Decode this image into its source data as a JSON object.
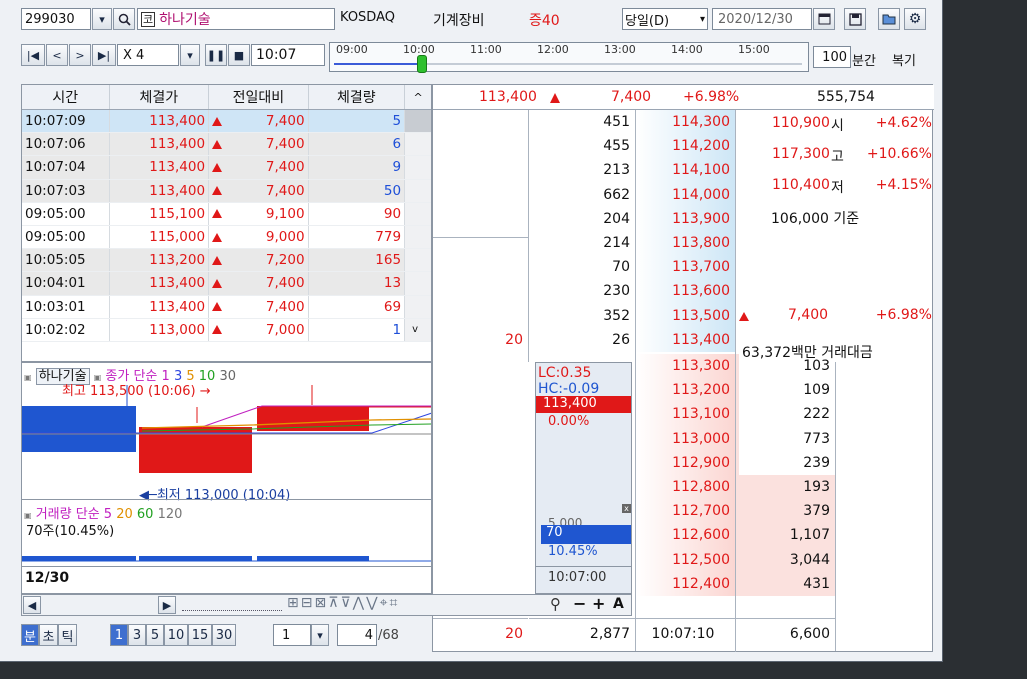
{
  "toolbar": {
    "code": "299030",
    "market_badge": "코",
    "stock_name": "하나기술",
    "exchange": "KOSDAQ",
    "sector": "기계장비",
    "margin": "증40",
    "period_select": "당일(D)",
    "date": "2020/12/30"
  },
  "toolbar2": {
    "speed": "X 4",
    "time": "10:07",
    "timeline_ticks": [
      "09:00",
      "10:00",
      "11:00",
      "12:00",
      "13:00",
      "14:00",
      "15:00"
    ],
    "interval_value": "100",
    "interval_unit": "분간",
    "restore": "복기"
  },
  "ticks": {
    "headers": [
      "시간",
      "체결가",
      "전일대비",
      "체결량"
    ],
    "rows": [
      {
        "time": "10:07:09",
        "price": "113,400",
        "change": "7,400",
        "vol": "5",
        "vol_color": "blue",
        "style": "sel"
      },
      {
        "time": "10:07:06",
        "price": "113,400",
        "change": "7,400",
        "vol": "6",
        "vol_color": "blue",
        "style": "alt"
      },
      {
        "time": "10:07:04",
        "price": "113,400",
        "change": "7,400",
        "vol": "9",
        "vol_color": "blue",
        "style": "alt"
      },
      {
        "time": "10:07:03",
        "price": "113,400",
        "change": "7,400",
        "vol": "50",
        "vol_color": "blue",
        "style": "alt"
      },
      {
        "time": "09:05:00",
        "price": "115,100",
        "change": "9,100",
        "vol": "90",
        "vol_color": "red",
        "style": ""
      },
      {
        "time": "09:05:00",
        "price": "115,000",
        "change": "9,000",
        "vol": "779",
        "vol_color": "red",
        "style": ""
      },
      {
        "time": "10:05:05",
        "price": "113,200",
        "change": "7,200",
        "vol": "165",
        "vol_color": "red",
        "style": "alt"
      },
      {
        "time": "10:04:01",
        "price": "113,400",
        "change": "7,400",
        "vol": "13",
        "vol_color": "red",
        "style": "alt"
      },
      {
        "time": "10:03:01",
        "price": "113,400",
        "change": "7,400",
        "vol": "69",
        "vol_color": "red",
        "style": ""
      },
      {
        "time": "10:02:02",
        "price": "113,000",
        "change": "7,000",
        "vol": "1",
        "vol_color": "blue",
        "style": ""
      }
    ]
  },
  "quote": {
    "price": "113,400",
    "change": "7,400",
    "pct": "+6.98%",
    "volume": "555,754"
  },
  "asks": [
    {
      "qty": "451",
      "price": "114,300"
    },
    {
      "qty": "455",
      "price": "114,200"
    },
    {
      "qty": "213",
      "price": "114,100"
    },
    {
      "qty": "662",
      "price": "114,000"
    },
    {
      "qty": "204",
      "price": "113,900"
    },
    {
      "qty": "214",
      "price": "113,800"
    },
    {
      "qty": "70",
      "price": "113,700"
    },
    {
      "qty": "230",
      "price": "113,600"
    },
    {
      "qty": "352",
      "price": "113,500"
    },
    {
      "qty": "26",
      "price": "113,400"
    }
  ],
  "ask_extra": "20",
  "bids": [
    {
      "price": "113,300",
      "qty": "103"
    },
    {
      "price": "113,200",
      "qty": "109"
    },
    {
      "price": "113,100",
      "qty": "222"
    },
    {
      "price": "113,000",
      "qty": "773"
    },
    {
      "price": "112,900",
      "qty": "239"
    },
    {
      "price": "112,800",
      "qty": "193"
    },
    {
      "price": "112,700",
      "qty": "379"
    },
    {
      "price": "112,600",
      "qty": "1,107"
    },
    {
      "price": "112,500",
      "qty": "3,044"
    },
    {
      "price": "112,400",
      "qty": "431"
    }
  ],
  "info": {
    "open": "110,900",
    "open_label": "시",
    "open_pct": "+4.62%",
    "high": "117,300",
    "high_label": "고",
    "high_pct": "+10.66%",
    "low": "110,400",
    "low_label": "저",
    "low_pct": "+4.15%",
    "base": "106,000",
    "base_label": "기준",
    "change": "7,400",
    "change_pct": "+6.98%",
    "amount": "63,372백만",
    "amount_label": "거래대금"
  },
  "chart": {
    "legend_name": "하나기술",
    "legend_price": "종가",
    "legend_type": "단순",
    "ma": [
      "1",
      "3",
      "5",
      "10",
      "30"
    ],
    "high_label": "최고 113,500 (10:06)",
    "low_label": "최저 113,000 (10:04)",
    "lc": "LC:0.35",
    "hc": "HC:-0.09",
    "price_tag": "113,400",
    "pct_tag": "0.00%",
    "vol_legend": "거래량",
    "vol_type": "단순",
    "vol_ma": [
      "5",
      "20",
      "60",
      "120"
    ],
    "vol_label": "70주(10.45%)",
    "vol_tag": "70",
    "vol_pct": "10.45%",
    "vol_hidden": "5,000",
    "date": "12/30",
    "time": "10:07:00",
    "chart_data": {
      "type": "candlestick",
      "candles": [
        {
          "open": 113300,
          "high": 113300,
          "low": 113000,
          "close": 113000
        },
        {
          "open": 113000,
          "high": 113400,
          "low": 113000,
          "close": 113400
        },
        {
          "open": 113400,
          "high": 113500,
          "low": 113400,
          "close": 113400
        }
      ]
    }
  },
  "bottom": {
    "tabs": [
      "분",
      "초",
      "틱"
    ],
    "intervals": [
      "1",
      "3",
      "5",
      "10",
      "15",
      "30"
    ],
    "count": "1",
    "page": "4",
    "total": "/68",
    "sum_left": "20",
    "sum_mid": "2,877",
    "clock": "10:07:10",
    "sum_right": "6,600"
  }
}
